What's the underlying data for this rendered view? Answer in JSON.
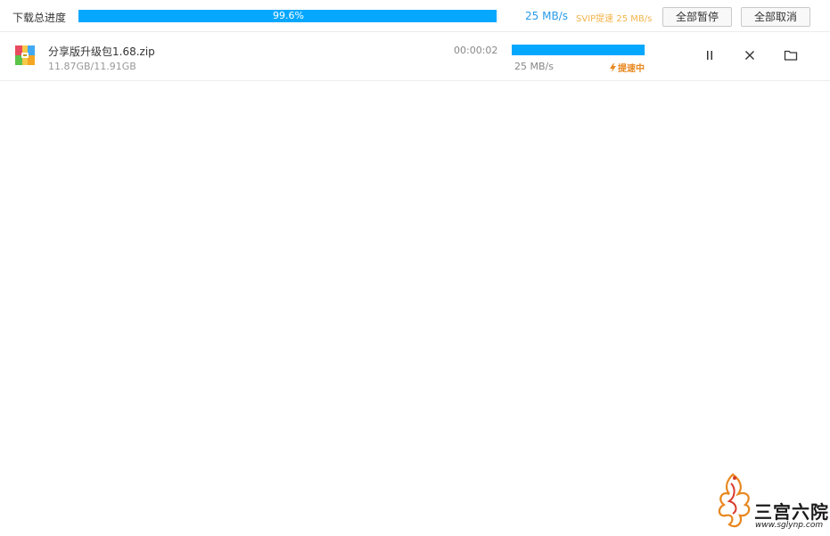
{
  "summary": {
    "label": "下载总进度",
    "progress_text": "99.6%",
    "progress_value": 99.6,
    "speed": "25 MB/s",
    "svip_note": "SVIP提速 25 MB/s",
    "pause_all_label": "全部暂停",
    "cancel_all_label": "全部取消"
  },
  "tasks": [
    {
      "file_name": "分享版升级包1.68.zip",
      "size_text": "11.87GB/11.91GB",
      "remaining": "00:00:02",
      "progress_value": 99.6,
      "speed": "25 MB/s",
      "boost_label": "提速中",
      "icon": "archive-icon"
    }
  ],
  "watermark": {
    "text": "三宫六院",
    "url": "www.sglynp.com"
  },
  "colors": {
    "accent": "#06a7ff",
    "speed_blue": "#2a9be8",
    "svip_gold": "#f3b44a",
    "boost_orange": "#e8871e"
  }
}
